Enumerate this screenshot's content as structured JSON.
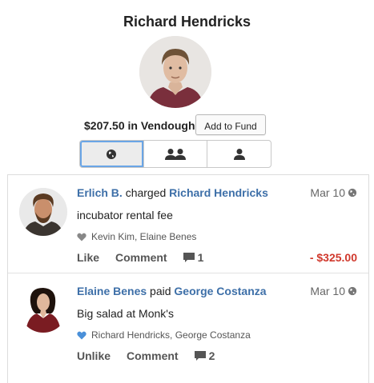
{
  "profile": {
    "name": "Richard Hendricks",
    "balance_text": "$207.50 in Vendough",
    "add_fund_label": "Add to Fund"
  },
  "tabs": [
    {
      "icon": "globe-icon",
      "active": true
    },
    {
      "icon": "friends-icon",
      "active": false
    },
    {
      "icon": "person-icon",
      "active": false
    }
  ],
  "feed": [
    {
      "actor": "Erlich B.",
      "verb": "charged",
      "target": "Richard Hendricks",
      "date": "Mar 10",
      "note": "incubator rental fee",
      "liked": false,
      "likes_text": "Kevin Kim, Elaine Benes",
      "like_label": "Like",
      "comment_label": "Comment",
      "comment_count": "1",
      "amount": "- $325.00"
    },
    {
      "actor": "Elaine Benes",
      "verb": "paid",
      "target": "George Costanza",
      "date": "Mar 10",
      "note": "Big salad at Monk's",
      "liked": true,
      "likes_text": "Richard Hendricks, George Costanza",
      "like_label": "Unlike",
      "comment_label": "Comment",
      "comment_count": "2",
      "amount": ""
    }
  ],
  "colors": {
    "link": "#3d6fa8",
    "negative_amount": "#d0382c",
    "liked_heart": "#4a90d9",
    "tab_focus": "#6aa5e6"
  }
}
